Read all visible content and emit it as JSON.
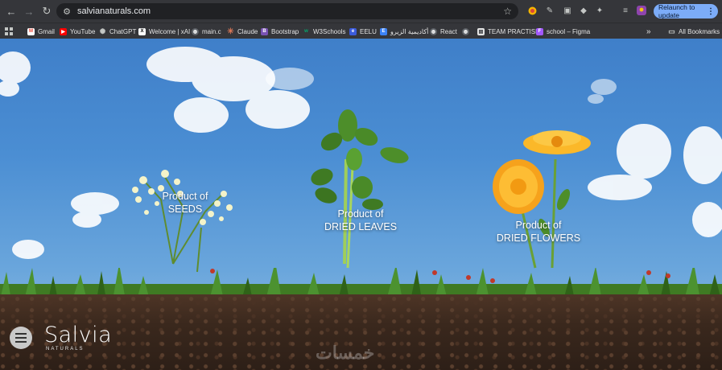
{
  "browser": {
    "url": "salvianaturals.com",
    "relaunch_label": "Relaunch to update",
    "bookmarks": [
      {
        "label": "Gmail",
        "icon": "gmail-icon",
        "color": "#ea4335"
      },
      {
        "label": "YouTube",
        "icon": "youtube-icon",
        "color": "#ff0000"
      },
      {
        "label": "ChatGPT",
        "icon": "chatgpt-icon",
        "color": "#c4c7c5"
      },
      {
        "label": "Welcome | xAI",
        "icon": "xai-icon",
        "color": "#ffffff"
      },
      {
        "label": "main.c",
        "icon": "globe-icon",
        "color": "#c4c7c5"
      },
      {
        "label": "Claude",
        "icon": "claude-icon",
        "color": "#d97757"
      },
      {
        "label": "Bootstrap",
        "icon": "bootstrap-icon",
        "color": "#7952b3"
      },
      {
        "label": "W3Schools",
        "icon": "w3schools-icon",
        "color": "#04aa6d"
      },
      {
        "label": "EELU",
        "icon": "eelu-icon",
        "color": "#3b5bdb"
      },
      {
        "label": "أكاديمية الزيرو",
        "icon": "zero-academy-icon",
        "color": "#3b82f6"
      },
      {
        "label": "React",
        "icon": "globe-icon",
        "color": "#c4c7c5"
      },
      {
        "label": "",
        "icon": "globe-icon",
        "color": "#c4c7c5"
      },
      {
        "label": "TEAM PRACTISE",
        "icon": "document-icon",
        "color": "#e3e3e3"
      },
      {
        "label": "school – Figma",
        "icon": "figma-icon",
        "color": "#a259ff"
      }
    ],
    "more_label": "»",
    "all_bookmarks_label": "All Bookmarks"
  },
  "hero": {
    "products": [
      {
        "line1": "Product of",
        "line2": "SEEDS"
      },
      {
        "line1": "Product of",
        "line2": "DRIED LEAVES"
      },
      {
        "line1": "Product of",
        "line2": "DRIED FLOWERS"
      }
    ],
    "logo": {
      "name": "Salvia",
      "sub": "NATURALS"
    },
    "watermark": "خمسات"
  },
  "colors": {
    "sky": "#4b8ed3",
    "soil": "#3a281d",
    "grass": "#3f7a23",
    "flower": "#f6a21c",
    "relaunch": "#7cacf8"
  }
}
